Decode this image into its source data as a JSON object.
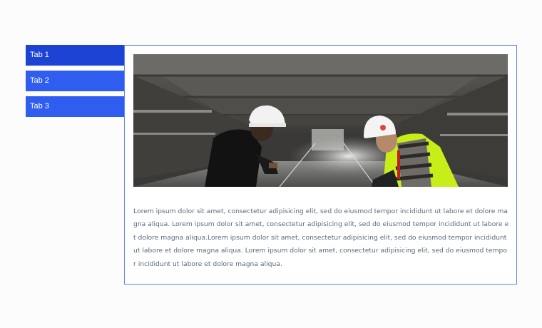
{
  "tabs": [
    {
      "label": "Tab 1",
      "active": true
    },
    {
      "label": "Tab 2",
      "active": false
    },
    {
      "label": "Tab 3",
      "active": false
    }
  ],
  "panel": {
    "image": "construction-workers-in-parking-garage",
    "text": "Lorem ipsum dolor sit amet, consectetur adipisicing elit, sed do eiusmod tempor incididunt ut labore et dolore magna aliqua. Lorem ipsum dolor sit amet, consectetur adipisicing elit, sed do eiusmod tempor incididunt ut labore et dolore magna aliqua.Lorem ipsum dolor sit amet, consectetur adipisicing elit, sed do eiusmod tempor incididunt ut labore et dolore magna aliqua. Lorem ipsum dolor sit amet, consectetur adipisicing elit, sed do eiusmod tempor incididunt ut labore et dolore magna aliqua."
  },
  "colors": {
    "tab_active": "#1d43d4",
    "tab": "#2f5df0",
    "panel_border": "#5b84f0",
    "text": "#5a6a7e"
  }
}
